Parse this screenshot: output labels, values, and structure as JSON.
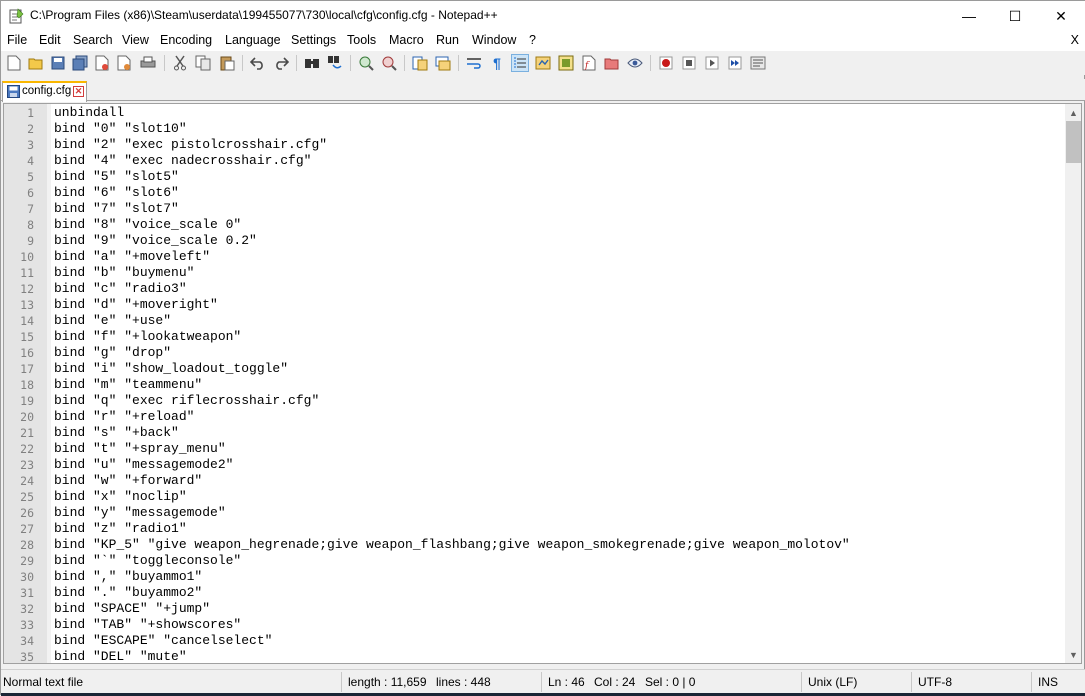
{
  "window": {
    "title": "C:\\Program Files (x86)\\Steam\\userdata\\199455077\\730\\local\\cfg\\config.cfg - Notepad++",
    "minimize_glyph": "—",
    "maximize_glyph": "☐",
    "close_glyph": "✕"
  },
  "menu": {
    "items": [
      "File",
      "Edit",
      "Search",
      "View",
      "Encoding",
      "Language",
      "Settings",
      "Tools",
      "Macro",
      "Run",
      "Window",
      "?"
    ],
    "close_doc": "X"
  },
  "toolbar": {
    "icons": [
      "new-file-icon",
      "open-file-icon",
      "save-icon",
      "save-all-icon",
      "close-icon",
      "close-all-icon",
      "print-icon",
      "cut-icon",
      "copy-icon",
      "paste-icon",
      "undo-icon",
      "redo-icon",
      "find-icon",
      "replace-icon",
      "zoom-in-icon",
      "zoom-out-icon",
      "sync-vertical-icon",
      "sync-horizontal-icon",
      "word-wrap-icon",
      "show-all-chars-icon",
      "indent-guide-icon",
      "user-language-icon",
      "document-map-icon",
      "function-list-icon",
      "folder-workspace-icon",
      "monitoring-icon",
      "record-macro-icon",
      "stop-macro-icon",
      "play-macro-icon",
      "run-macro-multiple-icon",
      "save-macro-icon"
    ]
  },
  "tab": {
    "label": "config.cfg",
    "close_glyph": "✕"
  },
  "editor": {
    "lines": [
      {
        "n": "1",
        "text": "unbindall"
      },
      {
        "n": "2",
        "text": "bind \"0\" \"slot10\""
      },
      {
        "n": "3",
        "text": "bind \"2\" \"exec pistolcrosshair.cfg\""
      },
      {
        "n": "4",
        "text": "bind \"4\" \"exec nadecrosshair.cfg\""
      },
      {
        "n": "5",
        "text": "bind \"5\" \"slot5\""
      },
      {
        "n": "6",
        "text": "bind \"6\" \"slot6\""
      },
      {
        "n": "7",
        "text": "bind \"7\" \"slot7\""
      },
      {
        "n": "8",
        "text": "bind \"8\" \"voice_scale 0\""
      },
      {
        "n": "9",
        "text": "bind \"9\" \"voice_scale 0.2\""
      },
      {
        "n": "10",
        "text": "bind \"a\" \"+moveleft\""
      },
      {
        "n": "11",
        "text": "bind \"b\" \"buymenu\""
      },
      {
        "n": "12",
        "text": "bind \"c\" \"radio3\""
      },
      {
        "n": "13",
        "text": "bind \"d\" \"+moveright\""
      },
      {
        "n": "14",
        "text": "bind \"e\" \"+use\""
      },
      {
        "n": "15",
        "text": "bind \"f\" \"+lookatweapon\""
      },
      {
        "n": "16",
        "text": "bind \"g\" \"drop\""
      },
      {
        "n": "17",
        "text": "bind \"i\" \"show_loadout_toggle\""
      },
      {
        "n": "18",
        "text": "bind \"m\" \"teammenu\""
      },
      {
        "n": "19",
        "text": "bind \"q\" \"exec riflecrosshair.cfg\""
      },
      {
        "n": "20",
        "text": "bind \"r\" \"+reload\""
      },
      {
        "n": "21",
        "text": "bind \"s\" \"+back\""
      },
      {
        "n": "22",
        "text": "bind \"t\" \"+spray_menu\""
      },
      {
        "n": "23",
        "text": "bind \"u\" \"messagemode2\""
      },
      {
        "n": "24",
        "text": "bind \"w\" \"+forward\""
      },
      {
        "n": "25",
        "text": "bind \"x\" \"noclip\""
      },
      {
        "n": "26",
        "text": "bind \"y\" \"messagemode\""
      },
      {
        "n": "27",
        "text": "bind \"z\" \"radio1\""
      },
      {
        "n": "28",
        "text": "bind \"KP_5\" \"give weapon_hegrenade;give weapon_flashbang;give weapon_smokegrenade;give weapon_molotov\""
      },
      {
        "n": "29",
        "text": "bind \"`\" \"toggleconsole\""
      },
      {
        "n": "30",
        "text": "bind \",\" \"buyammo1\""
      },
      {
        "n": "31",
        "text": "bind \".\" \"buyammo2\""
      },
      {
        "n": "32",
        "text": "bind \"SPACE\" \"+jump\""
      },
      {
        "n": "33",
        "text": "bind \"TAB\" \"+showscores\""
      },
      {
        "n": "34",
        "text": "bind \"ESCAPE\" \"cancelselect\""
      },
      {
        "n": "35",
        "text": "bind \"DEL\" \"mute\""
      }
    ]
  },
  "status": {
    "file_type": "Normal text file",
    "length": "length : 11,659",
    "lines": "lines : 448",
    "ln": "Ln : 46",
    "col": "Col : 24",
    "sel": "Sel : 0 | 0",
    "eol": "Unix (LF)",
    "encoding": "UTF-8",
    "mode": "INS"
  }
}
